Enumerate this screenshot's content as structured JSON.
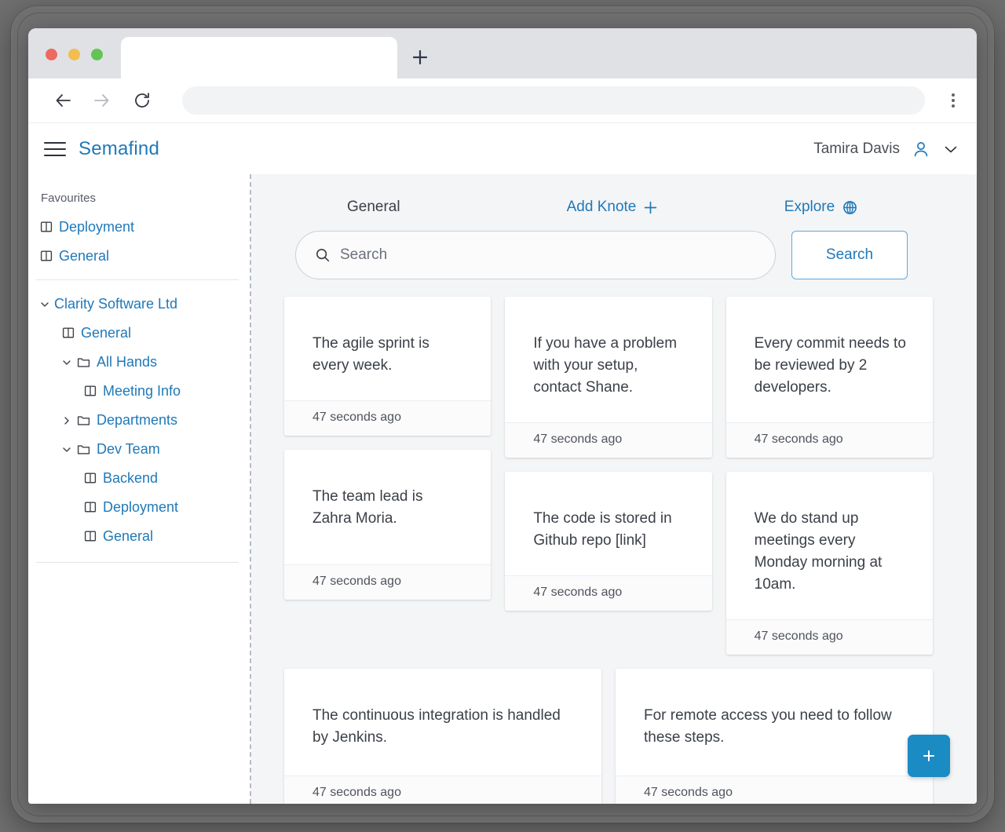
{
  "browser": {
    "tab_title": "",
    "url_value": "",
    "url_placeholder": "",
    "new_tab_label": "+",
    "back_label": "Back",
    "forward_label": "Forward",
    "reload_label": "Reload",
    "menu_label": "Menu"
  },
  "header": {
    "brand": "Semafind",
    "user_name": "Tamira Davis",
    "menu_icon": "hamburger-icon",
    "user_icon": "person-icon",
    "chevron_icon": "chevron-down-icon"
  },
  "sidebar": {
    "favourites_title": "Favourites",
    "favourites": [
      {
        "label": "Deployment",
        "icon": "book-icon"
      },
      {
        "label": "General",
        "icon": "book-icon"
      }
    ],
    "tree": [
      {
        "label": "Clarity Software Ltd",
        "icon": "none",
        "chevron": "down",
        "indent": 0
      },
      {
        "label": "General",
        "icon": "book-icon",
        "chevron": "none",
        "indent": 1
      },
      {
        "label": "All Hands",
        "icon": "folder-icon",
        "chevron": "down",
        "indent": 1
      },
      {
        "label": "Meeting Info",
        "icon": "book-icon",
        "chevron": "none",
        "indent": 2
      },
      {
        "label": "Departments",
        "icon": "folder-icon",
        "chevron": "right",
        "indent": 1
      },
      {
        "label": "Dev Team",
        "icon": "folder-icon",
        "chevron": "down",
        "indent": 1
      },
      {
        "label": "Backend",
        "icon": "book-icon",
        "chevron": "none",
        "indent": 2
      },
      {
        "label": "Deployment",
        "icon": "book-icon",
        "chevron": "none",
        "indent": 2
      },
      {
        "label": "General",
        "icon": "book-icon",
        "chevron": "none",
        "indent": 2
      }
    ]
  },
  "main": {
    "toolbar": {
      "current_section": "General",
      "add_knote_label": "Add Knote",
      "add_knote_icon": "plus-icon",
      "explore_label": "Explore",
      "explore_icon": "globe-icon"
    },
    "search": {
      "value": "",
      "placeholder": "Search",
      "icon": "search-icon",
      "button_label": "Search"
    },
    "columns": [
      [
        {
          "text": "The agile sprint is every week.",
          "timestamp": "47 seconds ago",
          "size": "h1"
        },
        {
          "text": "The team lead is Zahra Moria.",
          "timestamp": "47 seconds ago",
          "size": "h2"
        }
      ],
      [
        {
          "text": "If you have a problem with your setup, contact Shane.",
          "timestamp": "47 seconds ago",
          "size": "h2"
        },
        {
          "text": "The code is stored in Github repo [link]",
          "timestamp": "47 seconds ago",
          "size": "h1"
        }
      ],
      [
        {
          "text": "Every commit needs to be reviewed by 2 developers.",
          "timestamp": "47 seconds ago",
          "size": "h2"
        },
        {
          "text": "We do stand up meetings every Monday morning at 10am.",
          "timestamp": "47 seconds ago",
          "size": "h2"
        }
      ]
    ],
    "wide_cards": [
      {
        "text": "The continuous integration is handled by Jenkins.",
        "timestamp": "47 seconds ago"
      },
      {
        "text": "For remote access you need to follow these steps.",
        "timestamp": "47 seconds ago"
      }
    ],
    "fab": {
      "label": "+",
      "icon": "plus-icon",
      "color": "#1b8bc4"
    }
  },
  "colors": {
    "accent": "#2079b8",
    "fab": "#1b8bc4",
    "page_bg": "#f4f5f6",
    "card_bg": "#ffffff",
    "text": "#3b4048"
  }
}
